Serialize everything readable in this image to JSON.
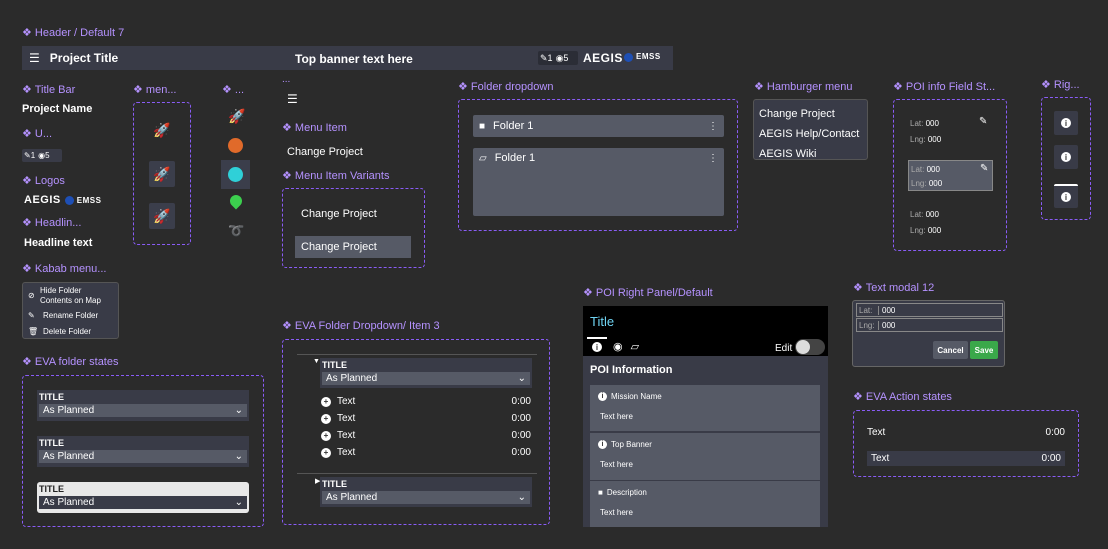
{
  "labels": {
    "header": "❖ Header / Default 7",
    "title_bar": "❖ Title Bar",
    "menu_short": "❖ men...",
    "icons_short": "❖ ...",
    "u_short": "❖ U...",
    "logos": "❖ Logos",
    "headline": "❖ Headlin...",
    "kabab": "❖ Kabab menu...",
    "eva_folder_states": "❖ EVA folder states",
    "ellipsis": "...",
    "menu_item": "❖ Menu Item",
    "menu_item_variants": "❖ Menu Item Variants",
    "eva_folder_dropdown": "❖ EVA Folder Dropdown/ Item 3",
    "folder_dropdown": "❖ Folder dropdown",
    "hamburger_menu": "❖ Hamburger menu",
    "poi_info_field": "❖ POI info Field St...",
    "right_short": "❖ Rig...",
    "poi_right_panel": "❖ POI Right Panel/Default",
    "text_modal": "❖ Text modal 12",
    "eva_action_states": "❖ EVA Action states"
  },
  "header": {
    "project_title": "Project Title",
    "banner": "Top banner text here",
    "edit_count": "1",
    "view_count": "5",
    "logo_text": "AEGIS",
    "ness": "EMSS"
  },
  "title_bar": {
    "project_name": "Project Name"
  },
  "user_counts": {
    "edit": "1",
    "view": "5"
  },
  "logos": {
    "text": "AEGIS",
    "ness": "EMSS"
  },
  "headline": "Headline text",
  "kabab_menu": {
    "items": [
      "Hide Folder Contents on Map",
      "Rename Folder",
      "Delete Folder"
    ]
  },
  "eva_folder_states": [
    {
      "title": "TITLE",
      "value": "As Planned"
    },
    {
      "title": "TITLE",
      "value": "As Planned"
    },
    {
      "title": "TITLE",
      "value": "As Planned"
    }
  ],
  "menu_item": "Change Project",
  "menu_item_variants": [
    "Change Project",
    "Change Project"
  ],
  "eva_dropdown": {
    "group1": {
      "title": "TITLE",
      "value": "As Planned"
    },
    "items": [
      {
        "text": "Text",
        "time": "0:00"
      },
      {
        "text": "Text",
        "time": "0:00"
      },
      {
        "text": "Text",
        "time": "0:00"
      },
      {
        "text": "Text",
        "time": "0:00"
      }
    ],
    "group2": {
      "title": "TITLE",
      "value": "As Planned"
    }
  },
  "folder_dropdown": [
    "Folder 1",
    "Folder 1"
  ],
  "hamburger_menu": [
    "Change Project",
    "AEGIS Help/Contact",
    "AEGIS Wiki"
  ],
  "poi_info": {
    "lat_label": "Lat:",
    "lng_label": "Lng:",
    "lat": "000",
    "lng": "000"
  },
  "poi_panel": {
    "title": "Title",
    "edit_label": "Edit",
    "heading": "POI Information",
    "fields": [
      {
        "label": "Mission Name",
        "value": "Text here"
      },
      {
        "label": "Top Banner",
        "value": "Text here"
      },
      {
        "label": "Description",
        "value": "Text here"
      }
    ]
  },
  "text_modal": {
    "lat_label": "Lat:",
    "lng_label": "Lng:",
    "lat": "000",
    "lng": "000",
    "cancel": "Cancel",
    "save": "Save"
  },
  "eva_action_states": [
    {
      "text": "Text",
      "time": "0:00"
    },
    {
      "text": "Text",
      "time": "0:00"
    }
  ],
  "colors": {
    "accent": "#b592ff",
    "bar": "#393b47",
    "save": "#3aa84a",
    "rocket": "#e0508f"
  }
}
